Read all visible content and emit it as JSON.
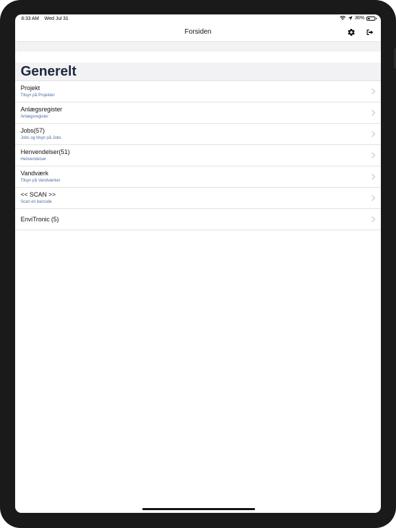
{
  "status_bar": {
    "time": "8:33 AM",
    "date": "Wed Jul 31",
    "battery_percent": "36%",
    "battery_level": 0.36
  },
  "nav": {
    "title": "Forsiden",
    "settings_icon": "gear-icon",
    "logout_icon": "sign-out-icon"
  },
  "section": {
    "title": "Generelt"
  },
  "items": [
    {
      "title": "Projekt",
      "subtitle": "Tilsyn på Projekter"
    },
    {
      "title": "Anlægsregister",
      "subtitle": "Anlægsregister"
    },
    {
      "title": "Jobs(57)",
      "subtitle": "Jobs og tilsyn på Jobs"
    },
    {
      "title": "Henvendelser(51)",
      "subtitle": "Henvendelser"
    },
    {
      "title": "Vandværk",
      "subtitle": "Tilsyn på Vandværker"
    },
    {
      "title": "<< SCAN >>",
      "subtitle": "Scan en barcode"
    },
    {
      "title": "EnviTronic (5)",
      "subtitle": ""
    }
  ],
  "colors": {
    "section_title": "#1e2a3e",
    "subtitle": "#4a6fa5",
    "band": "#f2f2f4"
  }
}
